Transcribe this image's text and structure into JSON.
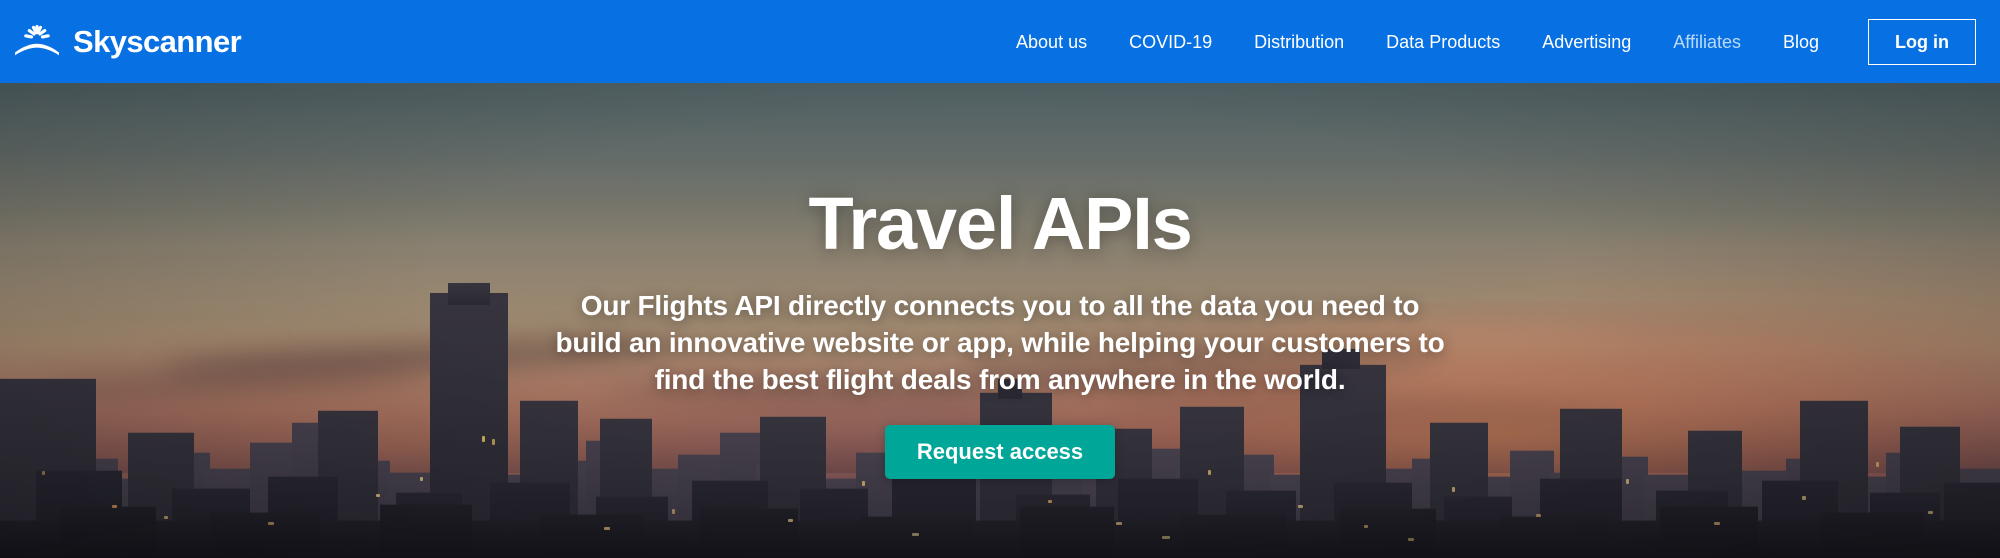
{
  "header": {
    "brand_name": "Skyscanner",
    "logo_icon": "skyscanner-sunburst-icon",
    "nav_items": [
      {
        "label": "About us",
        "dim": false
      },
      {
        "label": "COVID-19",
        "dim": false
      },
      {
        "label": "Distribution",
        "dim": false
      },
      {
        "label": "Data Products",
        "dim": false
      },
      {
        "label": "Advertising",
        "dim": false
      },
      {
        "label": "Affiliates",
        "dim": true
      },
      {
        "label": "Blog",
        "dim": false
      }
    ],
    "login_label": "Log in",
    "background_color": "#0770e3"
  },
  "hero": {
    "title": "Travel APIs",
    "subtitle": "Our Flights API directly connects you to all the data you need to build an innovative website or app, while helping your customers to find the best flight deals from anywhere in the world.",
    "cta_label": "Request access",
    "cta_color": "#00a698",
    "background_image_description": "City skyline at dusk with sunset sky"
  }
}
